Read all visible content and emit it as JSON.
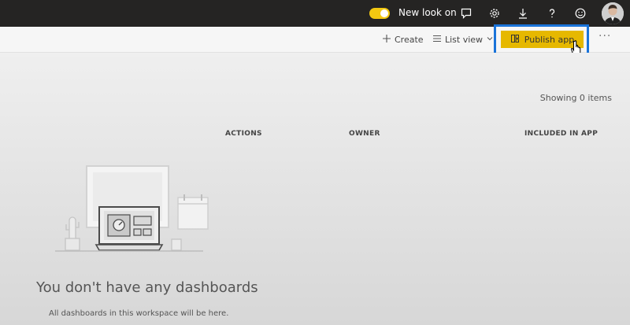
{
  "topbar": {
    "toggle_label": "New look on",
    "icons": [
      "chat-icon",
      "gear-icon",
      "download-icon",
      "help-icon",
      "smiley-icon"
    ]
  },
  "toolbar": {
    "create_label": "Create",
    "list_view_label": "List view",
    "publish_label": "Publish app",
    "more_label": "···"
  },
  "content": {
    "showing": "Showing 0 items",
    "columns": [
      "ACTIONS",
      "OWNER",
      "INCLUDED IN APP"
    ],
    "empty_title": "You don't have any dashboards",
    "empty_subtitle": "All dashboards in this workspace will be here."
  },
  "colors": {
    "topbar": "#252423",
    "accent": "#f2c811",
    "publish": "#e6b800",
    "highlight": "#1a73d9"
  }
}
